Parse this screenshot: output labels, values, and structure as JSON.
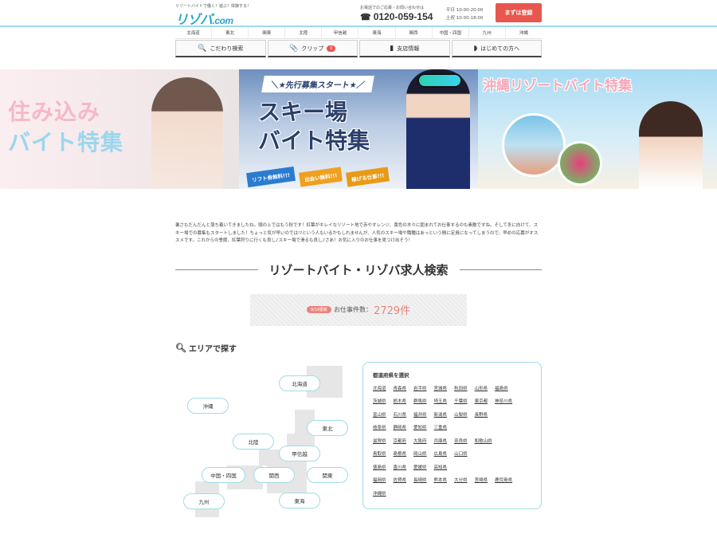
{
  "header": {
    "tagline": "リゾートバイトで働く！遊ぶ！体験する！",
    "logo_main": "リゾバ",
    "logo_suffix": ".com",
    "tel_note": "お電話でのご応募・お問い合わせは",
    "tel": "0120-059-154",
    "hours_weekday": "平日 10:00-20:00",
    "hours_weekend": "土祝 10:00-18:00",
    "cta_label": "まずは登録"
  },
  "region_nav": [
    "北海道",
    "東北",
    "関東",
    "北陸",
    "甲信越",
    "東海",
    "関西",
    "中国・四国",
    "九州",
    "沖縄"
  ],
  "util_nav": {
    "search": "こだわり検索",
    "clip": "クリップ",
    "clip_count": "0",
    "branches": "支店情報",
    "beginners": "はじめての方へ"
  },
  "banners": {
    "b1_line1": "住み込み",
    "b1_line2": "バイト特集",
    "b2_ribbon": "＼★先行募集スタート★／",
    "b2_line1": "スキー場",
    "b2_line2": "バイト特集",
    "b2_badge1": "リフト券無料!!!",
    "b2_badge2": "出会い無料!!!",
    "b2_badge3": "稼げる仕事!!!",
    "b3_title": "沖縄リゾートバイト特集"
  },
  "intro": "暑さもだんだんと落ち着いてきましたね。頭の上ではもう秋です！紅葉がキレイなリゾート地で赤やオレンジ、黄色の木々に囲まれてお仕事するのも素敵ですね。そして冬に向けて、スキー場での募集もスタートしました！ちょっと気が早いのでは!?という人もいるかもしれませんが、人気のスキー場や職種はあっという間に定員になってしまうので、早めの応募がオススメです。これからの季節、紅葉狩りに行くも良し♪スキー場で滑るも良し♪さあ！お気に入りのお仕事を見つけ出そう！",
  "section_title": "リゾートバイト・リゾバ求人検索",
  "count": {
    "date_badge": "9/19更新",
    "label": "お仕事件数：",
    "value": "2729件"
  },
  "area_heading": "エリアで探す",
  "map_regions": {
    "hokkaido": "北海道",
    "okinawa": "沖縄",
    "tohoku": "東北",
    "hokuriku": "北陸",
    "koshinetsu": "甲信越",
    "chugoku_shikoku": "中国・四国",
    "kansai": "関西",
    "kanto": "関東",
    "kyushu": "九州",
    "tokai": "東海"
  },
  "prefectures": {
    "heading": "都道府県を選択",
    "rows": [
      [
        "北海道",
        "青森県",
        "岩手県",
        "宮城県",
        "秋田県",
        "山形県",
        "福島県"
      ],
      [
        "茨城県",
        "栃木県",
        "群馬県",
        "埼玉県",
        "千葉県",
        "東京都",
        "神奈川県"
      ],
      [
        "富山県",
        "石川県",
        "福井県",
        "新潟県",
        "山梨県",
        "長野県"
      ],
      [
        "岐阜県",
        "静岡県",
        "愛知県",
        "三重県"
      ],
      [
        "滋賀県",
        "京都府",
        "大阪府",
        "兵庫県",
        "奈良県",
        "和歌山県"
      ],
      [
        "鳥取県",
        "島根県",
        "岡山県",
        "広島県",
        "山口県"
      ],
      [
        "徳島県",
        "香川県",
        "愛媛県",
        "高知県"
      ],
      [
        "福岡県",
        "佐賀県",
        "長崎県",
        "熊本県",
        "大分県",
        "宮崎県",
        "鹿児島県"
      ],
      [
        "沖縄県"
      ]
    ]
  },
  "colors": {
    "accent": "#9fdbe9",
    "cta": "#e8574e",
    "count": "#e8857d"
  }
}
